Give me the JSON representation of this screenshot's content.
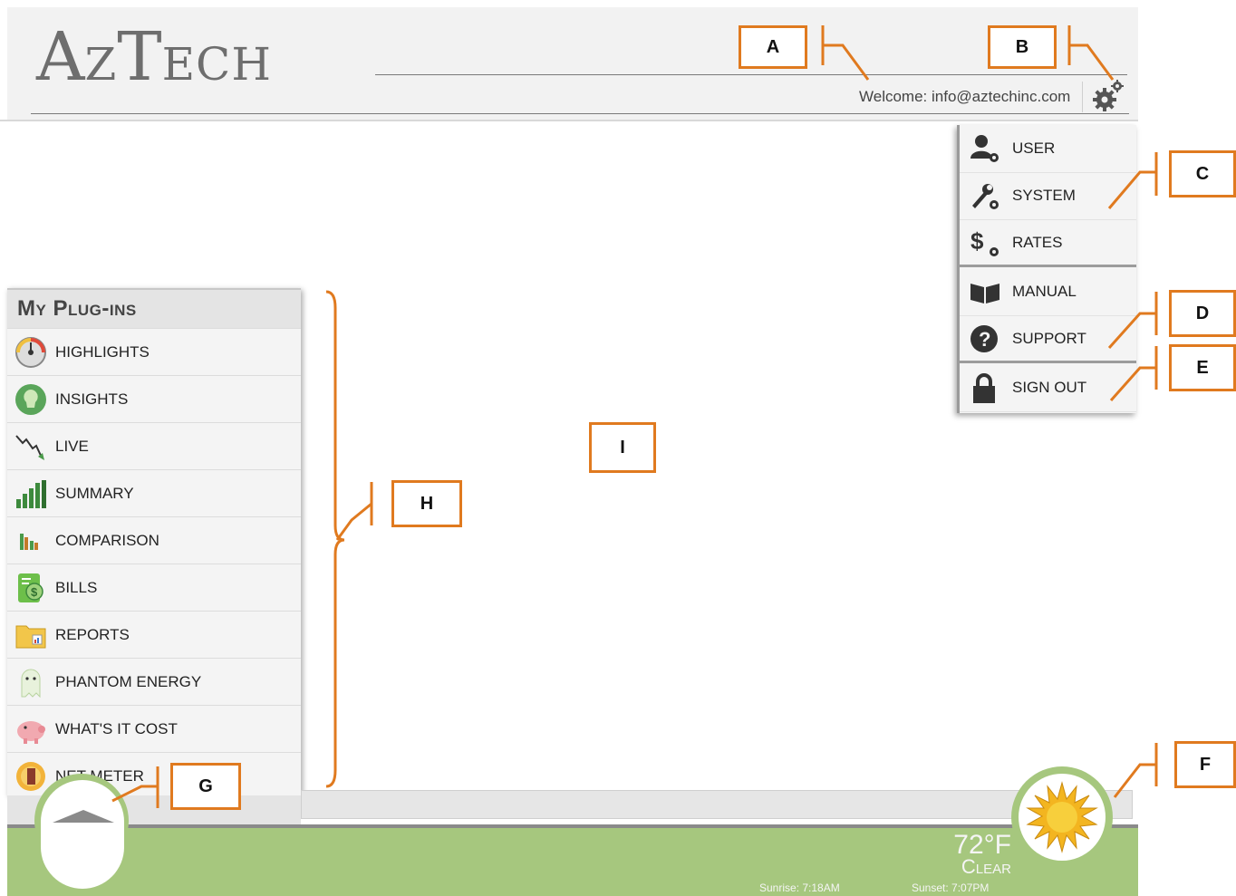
{
  "header": {
    "logo_big_a": "A",
    "logo_rest_1": "Z",
    "logo_big_t": "T",
    "logo_rest_2": "ECH",
    "welcome": "Welcome: info@aztechinc.com",
    "settings_icon": "gear-icon"
  },
  "settings_menu": {
    "items": [
      {
        "label": "USER",
        "icon": "user-gear-icon"
      },
      {
        "label": "SYSTEM",
        "icon": "wrench-gear-icon"
      },
      {
        "label": "RATES",
        "icon": "dollar-gear-icon"
      },
      {
        "label": "MANUAL",
        "icon": "book-icon"
      },
      {
        "label": "SUPPORT",
        "icon": "question-icon"
      },
      {
        "label": "SIGN OUT",
        "icon": "lock-icon"
      }
    ]
  },
  "plugins": {
    "title": "My Plug-ins",
    "items": [
      {
        "label": "HIGHLIGHTS",
        "icon": "gauge-icon"
      },
      {
        "label": "INSIGHTS",
        "icon": "lightbulb-icon"
      },
      {
        "label": "LIVE",
        "icon": "live-chart-icon"
      },
      {
        "label": "SUMMARY",
        "icon": "bar-chart-icon"
      },
      {
        "label": "COMPARISON",
        "icon": "comparison-chart-icon"
      },
      {
        "label": "BILLS",
        "icon": "bill-icon"
      },
      {
        "label": "REPORTS",
        "icon": "folder-icon"
      },
      {
        "label": "PHANTOM ENERGY",
        "icon": "ghost-icon"
      },
      {
        "label": "WHAT'S IT COST",
        "icon": "piggy-bank-icon"
      },
      {
        "label": "NET METER",
        "icon": "sun-meter-icon"
      }
    ]
  },
  "weather": {
    "temperature": "72°F",
    "condition": "Clear",
    "sunrise": "Sunrise: 7:18AM",
    "sunset": "Sunset: 7:07PM",
    "icon": "sun-icon"
  },
  "callouts": [
    "A",
    "B",
    "C",
    "D",
    "E",
    "F",
    "G",
    "H",
    "I"
  ],
  "colors": {
    "accent": "#e07a1f",
    "bottom_bar": "#a6c77e",
    "header_bg": "#f2f2f2"
  }
}
